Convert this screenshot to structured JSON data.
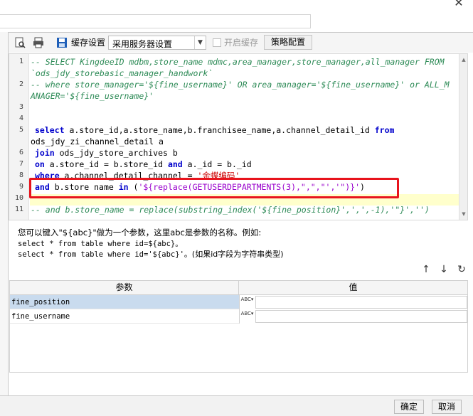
{
  "window": {
    "close_glyph": "✕"
  },
  "toolbar": {
    "cache_settings_label": "缓存设置",
    "cache_select_value": "采用服务器设置",
    "enable_cache_label": "开启缓存",
    "strategy_button": "策略配置"
  },
  "editor": {
    "line_numbers": [
      "1",
      "2",
      "3",
      "4",
      "5",
      "6",
      "7",
      "8",
      "9",
      "10",
      "11"
    ],
    "lines": {
      "l1a": "-- SELECT KingdeeID mdbm,store_name mdmc,area_manager,store_manager,all_manager FROM",
      "l1b": "`ods_jdy_storebasic_manager_handwork`",
      "l2a": "-- where store_manager='${fine_username}' OR area_manager='${fine_username}' or ALL_M",
      "l2b": "ANAGER='${fine_username}'",
      "l5_kw1": "select",
      "l5_mid": " a.store_id,a.store_name,b.franchisee_name,a.channel_detail_id ",
      "l5_kw2": "from",
      "l5b": "ods_jdy_zi_channel_detail a",
      "l6_kw": "join",
      "l6_rest": " ods_jdy_store_archives b",
      "l7_kw1": "on",
      "l7_mid": " a.store_id = b.store_id ",
      "l7_kw2": "and",
      "l7_rest": " a._id = b._id",
      "l8_kw": "where",
      "l8_mid": " a.channel_detail_channel = ",
      "l8_str": "'金蝶编码'",
      "l9_kw1": "and",
      "l9_mid": " b.store name ",
      "l9_kw2": "in",
      "l9_p": " (",
      "l9_str": "'${replace(GETUSERDEPARTMENTS(3),\",\",\"','\")}'",
      "l9_end": ")",
      "l11": "-- and b.store_name = replace(substring_index('${fine_position}',',',-1),'\"}','')"
    }
  },
  "hint": {
    "line1": "您可以键入\"${abc}\"做为一个参数，这里abc是参数的名称。例如:",
    "line2": "select * from table where id=${abc}。",
    "line3_code": "select * from table where id='${abc}'",
    "line3_note": "。(如果id字段为字符串类型)"
  },
  "actions": {
    "up": "↑",
    "down": "↓",
    "refresh": "↻"
  },
  "params": {
    "header_name": "参数",
    "header_value": "值",
    "type_glyph": "ABC",
    "rows": [
      {
        "name": "fine_position",
        "value": ""
      },
      {
        "name": "fine_username",
        "value": ""
      }
    ]
  },
  "footer": {
    "ok": "确定",
    "cancel": "取消"
  },
  "colors": {
    "highlight_box": "#e8141c",
    "keyword": "#0000cc",
    "comment": "#2e8b57",
    "string": "#cc0000"
  }
}
